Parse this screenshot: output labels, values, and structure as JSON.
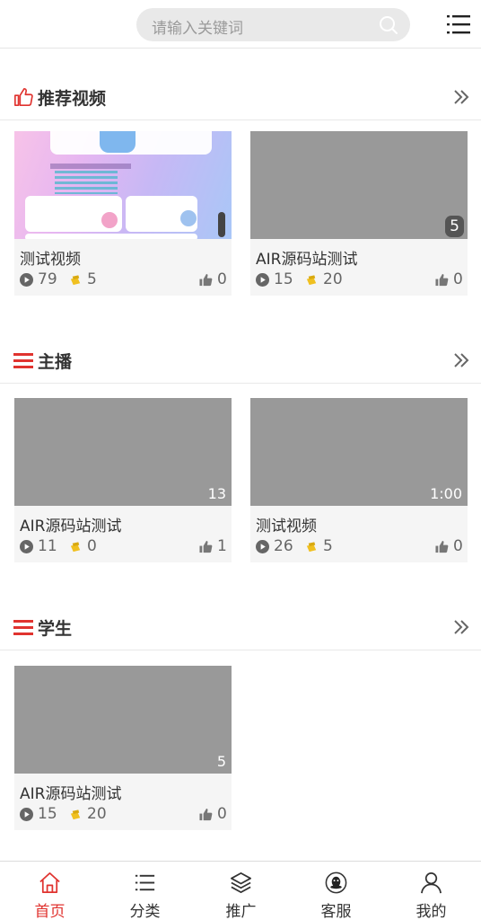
{
  "header": {
    "search_placeholder": "请输入关键词"
  },
  "sections": [
    {
      "title": "推荐视频",
      "icon": "thumb-up-icon",
      "cards": [
        {
          "title": "测试视频",
          "duration": "",
          "views": "79",
          "coins": "5",
          "likes": "0",
          "thumb": "image"
        },
        {
          "title": "AIR源码站测试",
          "duration": "5",
          "views": "15",
          "coins": "20",
          "likes": "0",
          "thumb": "gray"
        }
      ]
    },
    {
      "title": "主播",
      "icon": "list-icon",
      "cards": [
        {
          "title": "AIR源码站测试",
          "duration": "13",
          "views": "11",
          "coins": "0",
          "likes": "1",
          "thumb": "gray"
        },
        {
          "title": "测试视频",
          "duration": "1:00",
          "views": "26",
          "coins": "5",
          "likes": "0",
          "thumb": "gray"
        }
      ]
    },
    {
      "title": "学生",
      "icon": "list-icon",
      "cards": [
        {
          "title": "AIR源码站测试",
          "duration": "5",
          "views": "15",
          "coins": "20",
          "likes": "0",
          "thumb": "gray"
        }
      ]
    }
  ],
  "nav": [
    {
      "label": "首页",
      "icon": "home-icon",
      "active": true
    },
    {
      "label": "分类",
      "icon": "list-icon",
      "active": false
    },
    {
      "label": "推广",
      "icon": "layers-icon",
      "active": false
    },
    {
      "label": "客服",
      "icon": "qq-icon",
      "active": false
    },
    {
      "label": "我的",
      "icon": "user-icon",
      "active": false
    }
  ],
  "colors": {
    "accent": "#e0332f",
    "coin": "#f0c020",
    "thumb": "#999999"
  }
}
